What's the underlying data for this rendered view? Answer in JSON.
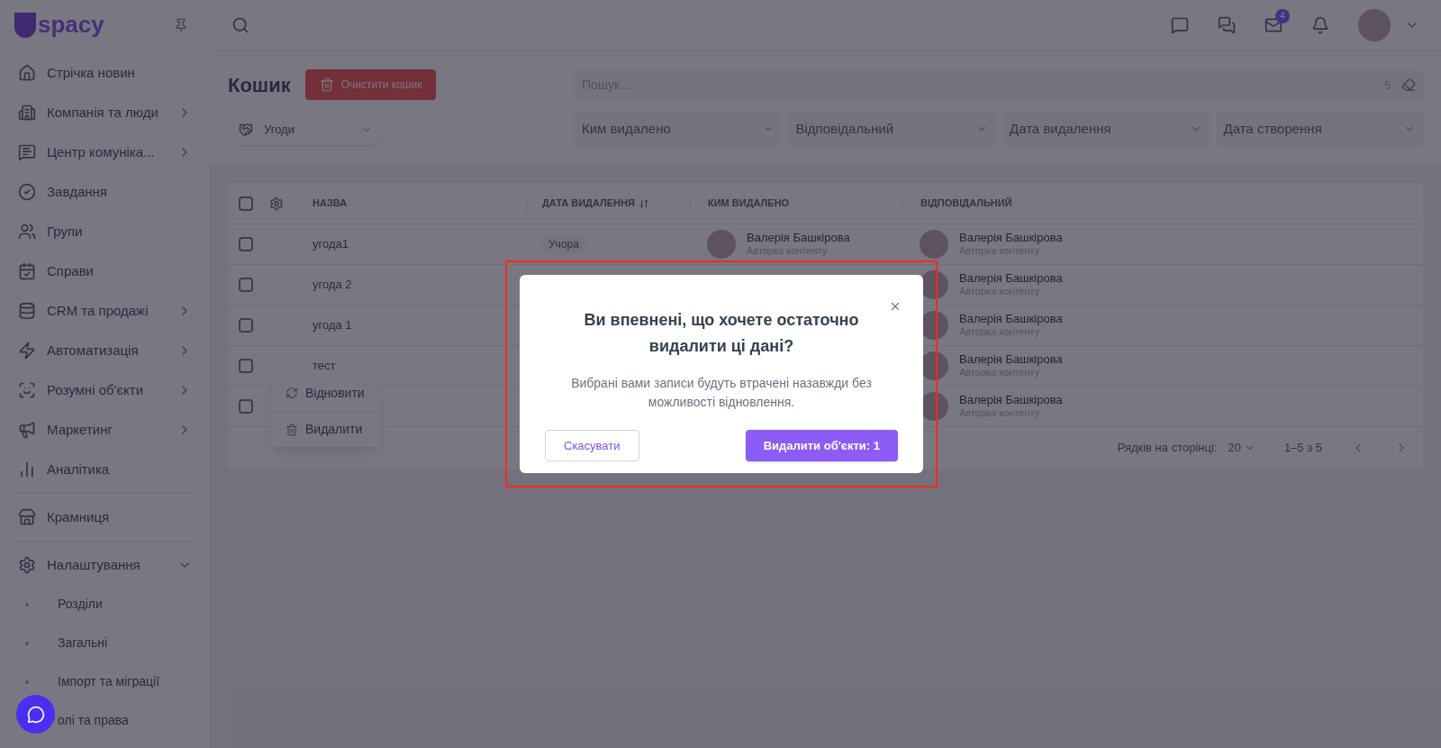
{
  "sidebar": {
    "logo": "spacy",
    "items": [
      {
        "label": "Стрічка новин"
      },
      {
        "label": "Компанія та люди",
        "expanded": false
      },
      {
        "label": "Центр комуніка...",
        "expanded": false
      },
      {
        "label": "Завдання"
      },
      {
        "label": "Групи"
      },
      {
        "label": "Справи"
      },
      {
        "label": "CRM та продажі",
        "expanded": false
      },
      {
        "label": "Автоматизація",
        "expanded": false
      },
      {
        "label": "Розумні об'єкти",
        "expanded": false
      },
      {
        "label": "Маркетинг",
        "expanded": false
      },
      {
        "label": "Аналітика"
      },
      {
        "label": "Крамниця"
      },
      {
        "label": "Налаштування",
        "expanded": true,
        "children": [
          {
            "label": "Розділи"
          },
          {
            "label": "Загальні"
          },
          {
            "label": "Імпорт та міграції"
          },
          {
            "label": "олі та права"
          }
        ]
      }
    ]
  },
  "topbar": {
    "mail_badge": "4"
  },
  "page": {
    "title": "Кошик",
    "clear_button": "Очистити кошик",
    "entity_select": "Угоди",
    "search": {
      "placeholder": "Пошук...",
      "count": "5"
    },
    "filters": [
      "Ким видалено",
      "Відповідальний",
      "Дата видалення",
      "Дата створення"
    ]
  },
  "table": {
    "select_all": false,
    "columns": [
      "НАЗВА",
      "ДАТА ВИДАЛЕННЯ",
      "КИМ ВИДАЛЕНО",
      "ВІДПОВІДАЛЬНИЙ"
    ],
    "rows": [
      {
        "checked": false,
        "name": "угода1",
        "date": "Учора",
        "deleted_by": {
          "name": "Валерія Башкірова",
          "role": "Авторка контенту"
        },
        "responsible": {
          "name": "Валерія Башкірова",
          "role": "Авторка контенту"
        }
      },
      {
        "checked": false,
        "name": "угода 2",
        "responsible": {
          "name": "Валерія Башкірова",
          "role": "Авторка контенту"
        }
      },
      {
        "checked": false,
        "name": "угода 1",
        "responsible": {
          "name": "Валерія Башкірова",
          "role": "Авторка контенту"
        }
      },
      {
        "checked": false,
        "name": "тест",
        "responsible": {
          "name": "Валерія Башкірова",
          "role": "Авторка контенту"
        }
      },
      {
        "checked": false,
        "responsible": {
          "name": "Валерія Башкірова",
          "role": "Авторка контенту"
        }
      }
    ],
    "footer": {
      "rows_label": "Рядків на сторінці:",
      "rows_value": "20",
      "range": "1–5 з 5"
    }
  },
  "context_menu": [
    "Відновити",
    "Видалити"
  ],
  "dialog": {
    "title": "Ви впевнені, що хочете остаточно видалити ці дані?",
    "text": "Вибрані вами записи будуть втрачені назавжди без можливості відновлення.",
    "cancel": "Скасувати",
    "confirm": "Видалити об'єкти: 1"
  }
}
